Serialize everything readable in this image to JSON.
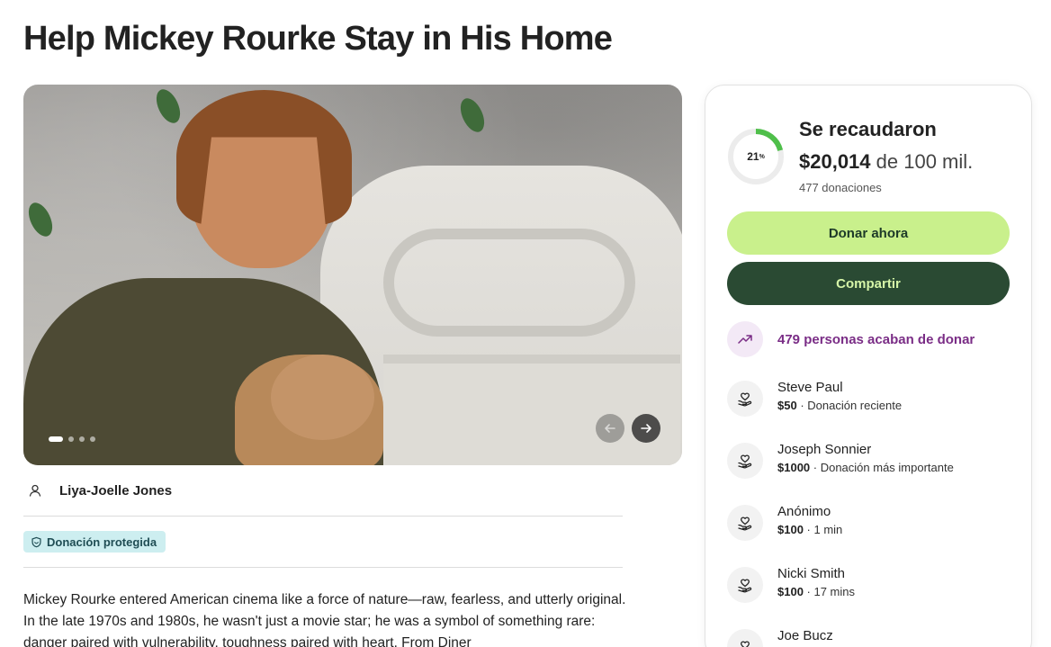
{
  "page": {
    "title": "Help Mickey Rourke Stay in His Home"
  },
  "gallery": {
    "slides": 4,
    "active_index": 0
  },
  "organizer": {
    "name": "Liya-Joelle Jones"
  },
  "badge": {
    "label": "Donación protegida"
  },
  "story": {
    "text": "Mickey Rourke entered American cinema like a force of nature—raw, fearless, and utterly original. In the late 1970s and 1980s, he wasn't just a movie star; he was a symbol of something rare: danger paired with vulnerability, toughness paired with heart. From Diner"
  },
  "progress": {
    "percent": 21,
    "percent_label": "21",
    "percent_sign": "%",
    "title": "Se recaudaron",
    "amount": "$20,014",
    "goal_text": "de 100 mil.",
    "donations": "477 donaciones"
  },
  "actions": {
    "donate": "Donar ahora",
    "share": "Compartir"
  },
  "recent": {
    "text": "479 personas acaban de donar"
  },
  "donors": [
    {
      "name": "Steve Paul",
      "amount": "$50",
      "detail": " · Donación reciente"
    },
    {
      "name": "Joseph Sonnier",
      "amount": "$1000",
      "detail": " · Donación más importante"
    },
    {
      "name": "Anónimo",
      "amount": "$100",
      "detail": " · 1 min"
    },
    {
      "name": "Nicki Smith",
      "amount": "$100",
      "detail": " · 17 mins"
    },
    {
      "name": "Joe Bucz",
      "amount": "",
      "detail": ""
    }
  ],
  "colors": {
    "accent_green": "#c9f08c",
    "dark_green": "#2a4a33",
    "purple": "#7a2d86",
    "badge_bg": "#cdeef0",
    "ring": "#4fbf4a"
  },
  "icons": {
    "organizer": "user-icon",
    "badge": "shield-icon",
    "recent": "trending-up-icon",
    "donor": "heart-hand-icon",
    "prev": "arrow-left-icon",
    "next": "arrow-right-icon"
  }
}
